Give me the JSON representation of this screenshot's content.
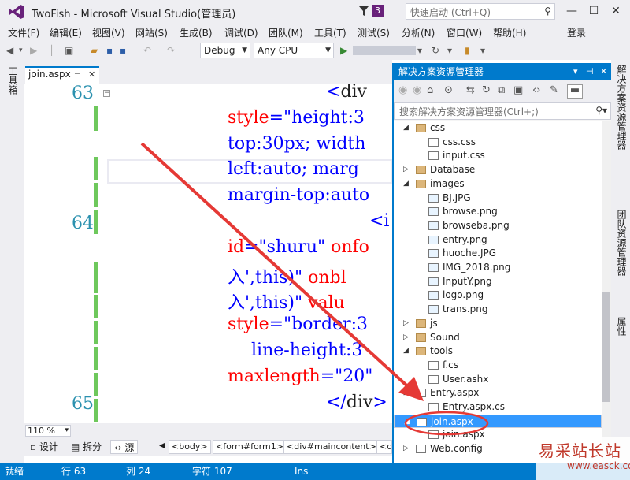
{
  "window": {
    "title": "TwoFish - Microsoft Visual Studio(管理员)",
    "notification_count": "3",
    "quick_launch_placeholder": "快速启动 (Ctrl+Q)",
    "minimize": "—",
    "maximize": "☐",
    "close": "✕"
  },
  "menu": [
    "文件(F)",
    "编辑(E)",
    "视图(V)",
    "网站(S)",
    "生成(B)",
    "调试(D)",
    "团队(M)",
    "工具(T)",
    "测试(S)",
    "分析(N)",
    "窗口(W)",
    "帮助(H)"
  ],
  "login": "登录",
  "toolbar": {
    "config": "Debug",
    "platform": "Any CPU"
  },
  "left_strip_label": "工具箱",
  "editor": {
    "tab_label": "join.aspx",
    "pin": "⊣",
    "close": "✕",
    "line_numbers": [
      "63",
      "64",
      "65"
    ],
    "lines": [
      {
        "parts": [
          {
            "t": "<",
            "c": "b"
          },
          {
            "t": "div",
            "c": "d"
          }
        ]
      },
      {
        "parts": [
          {
            "t": "style",
            "c": "r"
          },
          {
            "t": "=\"height:3",
            "c": "b"
          }
        ]
      },
      {
        "parts": [
          {
            "t": "top:30px; width",
            "c": "b"
          }
        ]
      },
      {
        "parts": [
          {
            "t": "left:auto; marg",
            "c": "b"
          }
        ]
      },
      {
        "parts": [
          {
            "t": "margin-top:auto",
            "c": "b"
          }
        ]
      },
      {
        "parts": [
          {
            "t": "<i",
            "c": "b"
          }
        ]
      },
      {
        "parts": [
          {
            "t": "id",
            "c": "r"
          },
          {
            "t": "=\"shuru\" ",
            "c": "b"
          },
          {
            "t": "onfo",
            "c": "r"
          }
        ]
      },
      {
        "parts": [
          {
            "t": "入',this)\" ",
            "c": "b"
          },
          {
            "t": "onbl",
            "c": "r"
          }
        ]
      },
      {
        "parts": [
          {
            "t": "入',this)\" ",
            "c": "b"
          },
          {
            "t": "valu",
            "c": "r"
          }
        ]
      },
      {
        "parts": [
          {
            "t": "style",
            "c": "r"
          },
          {
            "t": "=\"border:3",
            "c": "b"
          }
        ]
      },
      {
        "parts": [
          {
            "t": "line-height:3",
            "c": "b"
          }
        ]
      },
      {
        "parts": [
          {
            "t": "maxlength",
            "c": "r"
          },
          {
            "t": "=\"20\"",
            "c": "b"
          }
        ]
      },
      {
        "parts": [
          {
            "t": "</",
            "c": "b"
          },
          {
            "t": "div",
            "c": "d"
          },
          {
            "t": ">",
            "c": "b"
          }
        ]
      }
    ],
    "zoom": "110 %",
    "views": [
      "设计",
      "拆分",
      "源"
    ],
    "breadcrumbs": [
      "<body>",
      "<form#form1>",
      "<div#maincontent>",
      "<d"
    ]
  },
  "solution_explorer": {
    "title": "解决方案资源管理器",
    "search_placeholder": "搜索解决方案资源管理器(Ctrl+;)",
    "items": [
      {
        "label": "css",
        "level": 1,
        "kind": "folder",
        "expand": "open"
      },
      {
        "label": "css.css",
        "level": 2,
        "kind": "file"
      },
      {
        "label": "input.css",
        "level": 2,
        "kind": "file"
      },
      {
        "label": "Database",
        "level": 1,
        "kind": "folder",
        "expand": "closed"
      },
      {
        "label": "images",
        "level": 1,
        "kind": "folder",
        "expand": "open"
      },
      {
        "label": "BJ.JPG",
        "level": 2,
        "kind": "img"
      },
      {
        "label": "browse.png",
        "level": 2,
        "kind": "img"
      },
      {
        "label": "browseba.png",
        "level": 2,
        "kind": "img"
      },
      {
        "label": "entry.png",
        "level": 2,
        "kind": "img"
      },
      {
        "label": "huoche.JPG",
        "level": 2,
        "kind": "img"
      },
      {
        "label": "IMG_2018.png",
        "level": 2,
        "kind": "img"
      },
      {
        "label": "InputY.png",
        "level": 2,
        "kind": "img"
      },
      {
        "label": "logo.png",
        "level": 2,
        "kind": "img"
      },
      {
        "label": "trans.png",
        "level": 2,
        "kind": "img"
      },
      {
        "label": "js",
        "level": 1,
        "kind": "folder",
        "expand": "closed"
      },
      {
        "label": "Sound",
        "level": 1,
        "kind": "folder",
        "expand": "closed"
      },
      {
        "label": "tools",
        "level": 1,
        "kind": "folder",
        "expand": "open"
      },
      {
        "label": "f.cs",
        "level": 2,
        "kind": "file"
      },
      {
        "label": "User.ashx",
        "level": 2,
        "kind": "file"
      },
      {
        "label": "Entry.aspx",
        "level": 1,
        "kind": "file",
        "expand": "open"
      },
      {
        "label": "Entry.aspx.cs",
        "level": 2,
        "kind": "file"
      },
      {
        "label": "join.aspx",
        "level": 1,
        "kind": "file",
        "expand": "open",
        "selected": true
      },
      {
        "label": "join.aspx",
        "level": 2,
        "kind": "file"
      },
      {
        "label": "Web.config",
        "level": 1,
        "kind": "file",
        "expand": "closed"
      }
    ]
  },
  "right_strip": [
    "解决方案资源管理器",
    "团队资源管理器",
    "属性"
  ],
  "status": {
    "state": "就绪",
    "line": "行 63",
    "col": "列 24",
    "char": "字符 107",
    "mode": "Ins"
  },
  "watermark": {
    "name": "易采站长站",
    "url": "www.easck.com"
  },
  "colors": {
    "accent": "#007acc",
    "annotation": "#e53935"
  }
}
